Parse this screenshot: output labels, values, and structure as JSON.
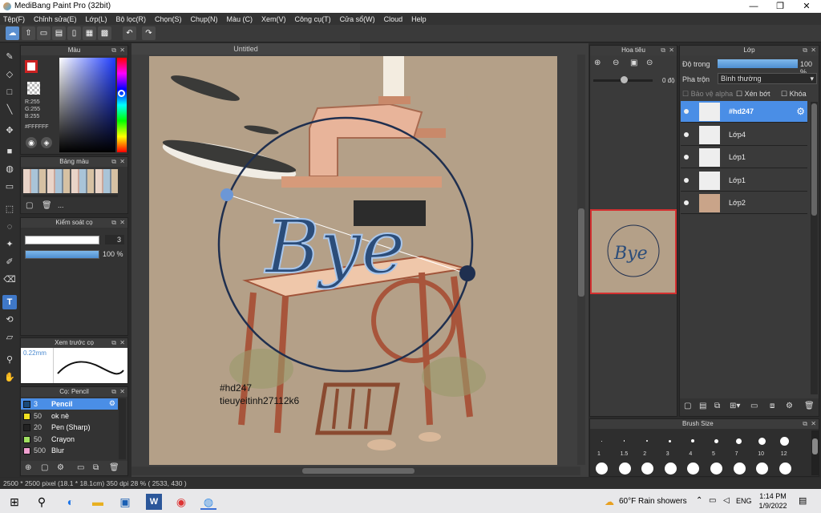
{
  "window": {
    "title": "MediBang Paint Pro (32bit)",
    "minimize": "—",
    "restore": "❐",
    "close": "✕"
  },
  "menu": [
    "Tệp(F)",
    "Chỉnh sửa(E)",
    "Lớp(L)",
    "Bộ lọc(R)",
    "Chọn(S)",
    "Chụp(N)",
    "Màu (C)",
    "Xem(V)",
    "Công cụ(T)",
    "Cửa sổ(W)",
    "Cloud",
    "Help"
  ],
  "color_panel": {
    "title": "Màu",
    "rgb": [
      "R:255",
      "G:255",
      "B:255"
    ],
    "hex": "#FFFFFF",
    "current_color": "#ffffff"
  },
  "palette_panel": {
    "title": "Bảng màu",
    "more": "..."
  },
  "brush_control": {
    "title": "Kiểm soát cọ",
    "size": "3",
    "opacity": "100 %",
    "opacity_fraction": 1.0
  },
  "brush_preview": {
    "title": "Xem trước cọ",
    "size": "0.22mm"
  },
  "brush_list": {
    "title": "Cọ: Pencil",
    "items": [
      {
        "size": "3",
        "name": "Pencil",
        "color": "#1a4a7a",
        "selected": true
      },
      {
        "size": "50",
        "name": "ok nè",
        "color": "#f0e020",
        "selected": false
      },
      {
        "size": "20",
        "name": "Pen (Sharp)",
        "color": "#222222",
        "selected": false
      },
      {
        "size": "50",
        "name": "Crayon",
        "color": "#a0e060",
        "selected": false
      },
      {
        "size": "500",
        "name": "Blur",
        "color": "#f0a0d0",
        "selected": false
      }
    ]
  },
  "document": {
    "tab": "Untitled",
    "art_text": "Bye",
    "watermark_1": "#hd247",
    "watermark_2": "tieuyeitinh27112k6"
  },
  "navigator": {
    "title": "Hoa tiêu",
    "rotation": "0 độ"
  },
  "layers": {
    "title": "Lớp",
    "opacity_label": "Độ trong",
    "opacity_value": "100 %",
    "blend_label": "Pha trộn",
    "blend_value": "Bình thường",
    "protect_alpha": "Bảo vệ alpha",
    "clipping": "Xén bớt",
    "lock": "Khóa",
    "items": [
      {
        "name": "#hd247",
        "selected": true
      },
      {
        "name": "Lớp4",
        "selected": false
      },
      {
        "name": "Lớp1",
        "selected": false
      },
      {
        "name": "Lớp1",
        "selected": false
      },
      {
        "name": "Lớp2",
        "selected": false
      }
    ]
  },
  "brush_size": {
    "title": "Brush Size",
    "labels": [
      "1",
      "1.5",
      "2",
      "3",
      "4",
      "5",
      "7",
      "10",
      "12"
    ]
  },
  "status": "2500 * 2500 pixel   (18.1 * 18.1cm)  350 dpi   28 %   ( 2533, 430 )",
  "taskbar": {
    "weather": "60°F  Rain showers",
    "lang": "ENG",
    "time": "1:14 PM",
    "date": "1/9/2022"
  }
}
